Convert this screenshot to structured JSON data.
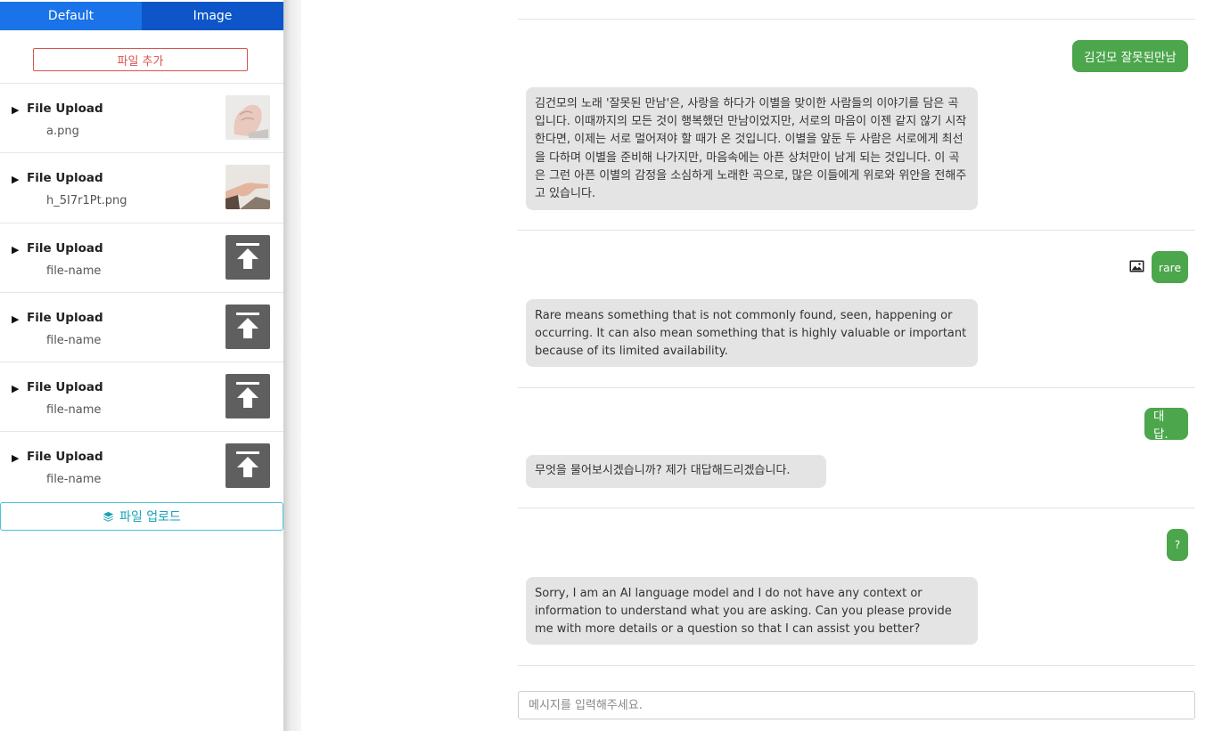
{
  "sidebar": {
    "tabs": [
      {
        "label": "Default"
      },
      {
        "label": "Image"
      }
    ],
    "add_file_label": "파일 추가",
    "files": [
      {
        "title": "File Upload",
        "name": "a.png",
        "thumb": "fist-photo"
      },
      {
        "title": "File Upload",
        "name": "h_5I7r1Pt.png",
        "thumb": "pointing-hand-photo"
      },
      {
        "title": "File Upload",
        "name": "file-name",
        "thumb": "upload-icon"
      },
      {
        "title": "File Upload",
        "name": "file-name",
        "thumb": "upload-icon"
      },
      {
        "title": "File Upload",
        "name": "file-name",
        "thumb": "upload-icon"
      },
      {
        "title": "File Upload",
        "name": "file-name",
        "thumb": "upload-icon"
      }
    ],
    "upload_label": "파일 업로드"
  },
  "chat": {
    "messages": [
      {
        "user": "김건모 잘못된만남",
        "bot": "김건모의 노래 '잘못된 만남'은, 사랑을 하다가 이별을 맞이한 사람들의 이야기를 담은 곡입니다. 이때까지의 모든 것이 행복했던 만남이었지만, 서로의 마음이 이젠 같지 않기 시작한다면, 이제는 서로 멀어져야 할 때가 온 것입니다. 이별을 앞둔 두 사람은 서로에게 최선을 다하며 이별을 준비해 나가지만, 마음속에는 아픈 상처만이 남게 되는 것입니다. 이 곡은 그런 아픈 이별의 감정을 소심하게 노래한 곡으로, 많은 이들에게 위로와 위안을 전해주고 있습니다."
      },
      {
        "user": "rare",
        "bot": "Rare means something that is not commonly found, seen, happening or occurring. It can also mean something that is highly valuable or important because of its limited availability."
      },
      {
        "user": "대답.",
        "bot": "무엇을 물어보시겠습니까? 제가 대답해드리겠습니다."
      },
      {
        "user": "?",
        "bot": "Sorry, I am an AI language model and I do not have any context or information to understand what you are asking. Can you please provide me with more details or a question so that I can assist you better?"
      }
    ],
    "input_placeholder": "메시지를 입력해주세요."
  },
  "colors": {
    "tab_default": "#1a73e8",
    "tab_image": "#0d55c8",
    "user_bubble": "#4ca64c",
    "bot_bubble": "#e4e4e4",
    "add_button": "#d9534f",
    "upload_button": "#17a2b8"
  }
}
